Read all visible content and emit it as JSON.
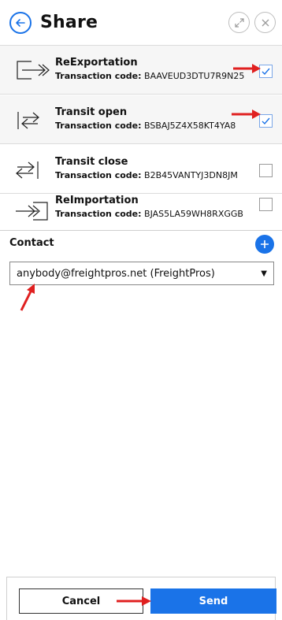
{
  "header": {
    "title": "Share",
    "back_icon": "arrow-left-circle-icon",
    "expand_icon": "expand-icon",
    "close_icon": "close-icon",
    "accent_color": "#1a73e8"
  },
  "transactions": [
    {
      "name": "ReExportation",
      "code_label": "Transaction code:",
      "code": "BAAVEUD3DTU7R9N25",
      "checked": true,
      "icon": "reexport-arrow-icon"
    },
    {
      "name": "Transit open",
      "code_label": "Transaction code:",
      "code": "BSBAJ5Z4X58KT4YA8",
      "checked": true,
      "icon": "transit-open-icon"
    },
    {
      "name": "Transit close",
      "code_label": "Transaction code:",
      "code": "B2B45VANTYJ3DN8JM",
      "checked": false,
      "icon": "transit-close-icon"
    },
    {
      "name": "ReImportation",
      "code_label": "Transaction code:",
      "code": "BJAS5LA59WH8RXGGB",
      "checked": false,
      "icon": "reimport-arrow-icon"
    }
  ],
  "contact": {
    "label": "Contact",
    "add_icon": "plus-icon",
    "selected": "anybody@freightpros.net (FreightPros)"
  },
  "footer": {
    "cancel_label": "Cancel",
    "send_label": "Send"
  },
  "annotation_color": "#e02020"
}
